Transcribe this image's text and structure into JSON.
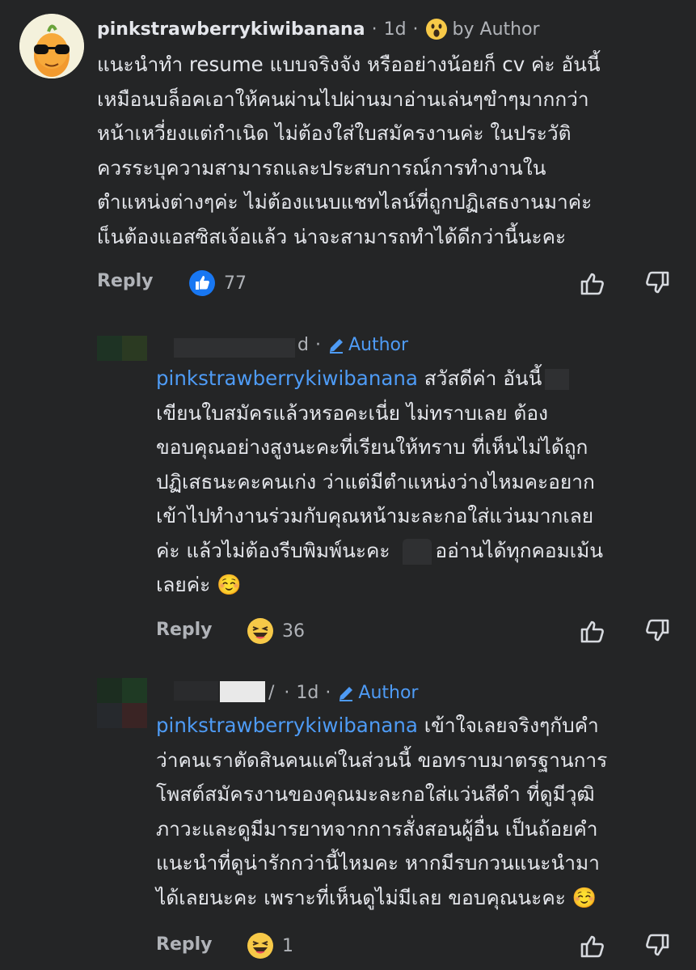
{
  "comments": [
    {
      "author": "pinkstrawberrykiwibanana",
      "time": "1d",
      "badge": "by Author",
      "lines": [
        "แนะนำทำ resume แบบจริงจัง หรืออย่างน้อยก็ cv ค่ะ อันนี้",
        "เหมือนบล็อคเอาให้คนผ่านไปผ่านมาอ่านเล่นๆขำๆมากกว่า",
        "หน้าเหวี่ยงแต่กำเนิด ไม่ต้องใส่ใบสมัครงานค่ะ ในประวัติ",
        "ควรระบุความสามารถและประสบการณ์การทำงานใน",
        "ตำแหน่งต่างๆค่ะ ไม่ต้องแนบแชทไลน์ที่ถูกปฏิเสธงานมาค่ะ",
        "เเ็นต้องแอสซิสเจ้อแล้ว น่าจะสามารถทำได้ดีกว่านี้นะคะ"
      ],
      "reply_label": "Reply",
      "reaction_count": "77"
    },
    {
      "time": "d",
      "badge": "Author",
      "mention": "pinkstrawberrykiwibanana",
      "first_line_rest": " สวัสดีค่า อันนี้",
      "lines": [
        "เขียนใบสมัครแล้วหรอคะเนี่ย ไม่ทราบเลย ต้อง",
        "ขอบคุณอย่างสูงนะคะที่เรียนให้ทราบ ที่เห็นไม่ได้ถูก",
        "ปฏิเสธนะคะคนเก่ง ว่าแต่มีตำแหน่งว่างไหมคะอยาก",
        "เข้าไปทำงานร่วมกับคุณหน้ามะละกอใส่แว่นมากเลย"
      ],
      "line6_a": "ค่ะ แล้วไม่ต้องรีบพิมพ์นะคะ",
      "line6_b": "ออ่านได้ทุกคอมเม้น",
      "line7": "เลยค่ะ ☺️",
      "reply_label": "Reply",
      "reaction_count": "36"
    },
    {
      "time": "1d",
      "badge": "Author",
      "mention": "pinkstrawberrykiwibanana",
      "first_line_rest": " เข้าใจเลยจริงๆกับคำ",
      "lines": [
        "ว่าคนเราตัดสินคนแค่ในส่วนนี้ ขอทราบมาตรฐานการ",
        "โพสต์สมัครงานของคุณมะละกอใส่แว่นสีดำ ที่ดูมีวุฒิ",
        "ภาวะและดูมีมารยาทจากการสั่งสอนผู้อื่น เป็นถ้อยคำ",
        "แนะนำที่ดูน่ารักกว่านี้ไหมคะ หากมีรบกวนแนะนำมา",
        "ได้เลยนะคะ เพราะที่เห็นดูไม่มีเลย ขอบคุณนะคะ ☺️"
      ],
      "reply_label": "Reply",
      "reaction_count": "1"
    }
  ],
  "icons": {
    "avatar": "papaya-sunglasses-avatar",
    "wow": "wow-face-icon",
    "like": "like-reaction-icon",
    "haha": "haha-face-icon",
    "pencil": "pencil-icon",
    "upvote": "thumbs-up-outline-icon",
    "downvote": "thumbs-down-outline-icon"
  },
  "colors": {
    "background": "#242526",
    "text": "#e4e6eb",
    "muted": "#b0b3b8",
    "link": "#4e9bf5"
  }
}
